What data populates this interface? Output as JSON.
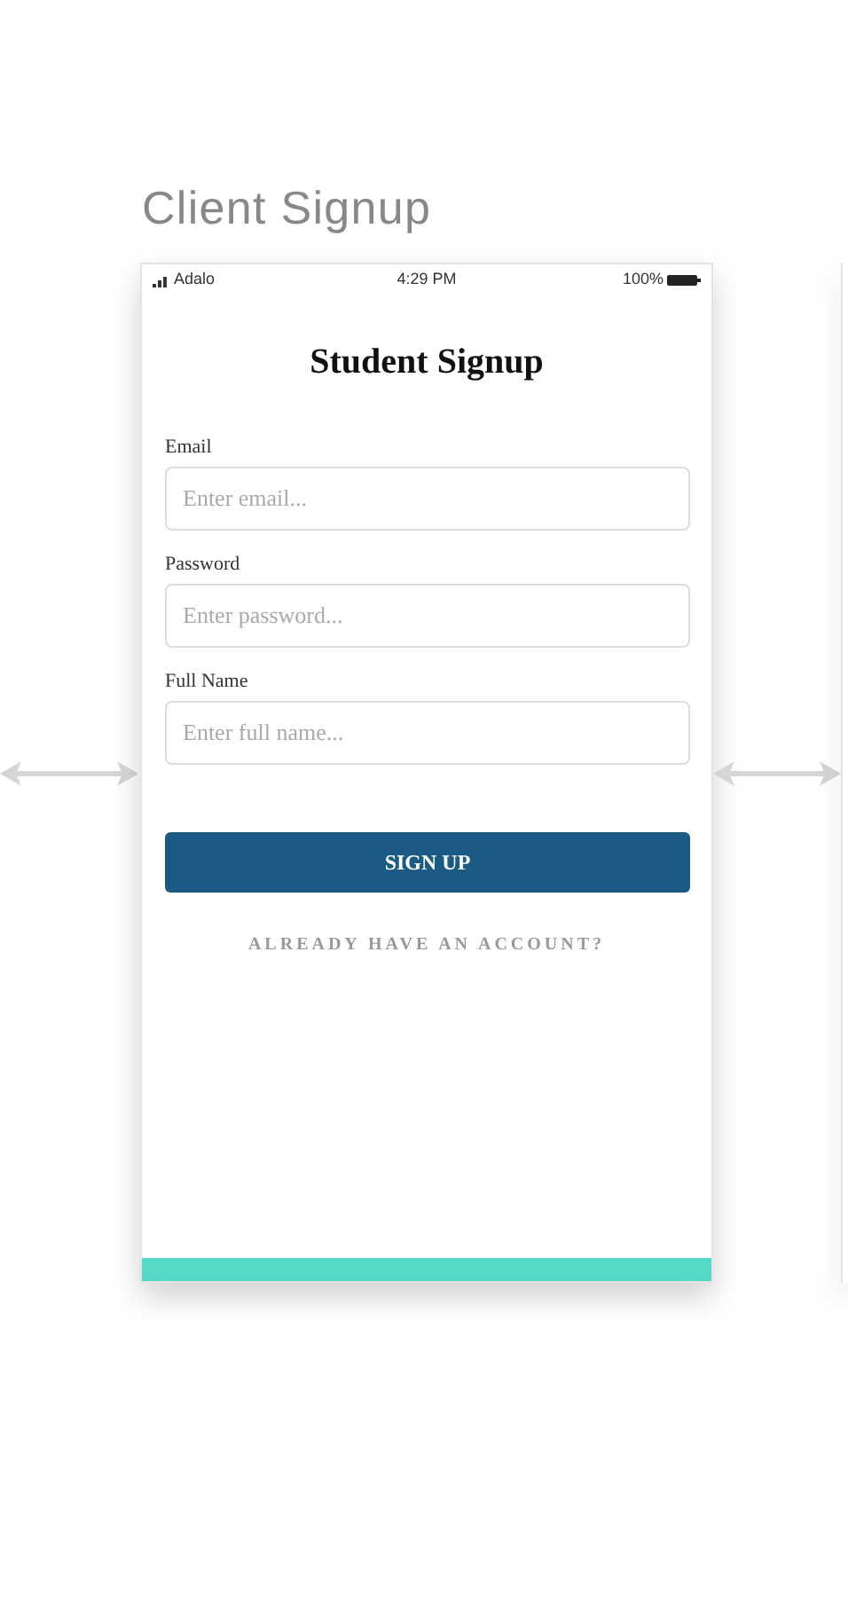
{
  "page_title": "Client Signup",
  "status_bar": {
    "carrier": "Adalo",
    "time": "4:29 PM",
    "battery": "100%"
  },
  "screen": {
    "title": "Student Signup",
    "fields": [
      {
        "label": "Email",
        "placeholder": "Enter email..."
      },
      {
        "label": "Password",
        "placeholder": "Enter password..."
      },
      {
        "label": "Full Name",
        "placeholder": "Enter full name..."
      }
    ],
    "primary_button": "SIGN UP",
    "link": "ALREADY HAVE AN ACCOUNT?"
  }
}
